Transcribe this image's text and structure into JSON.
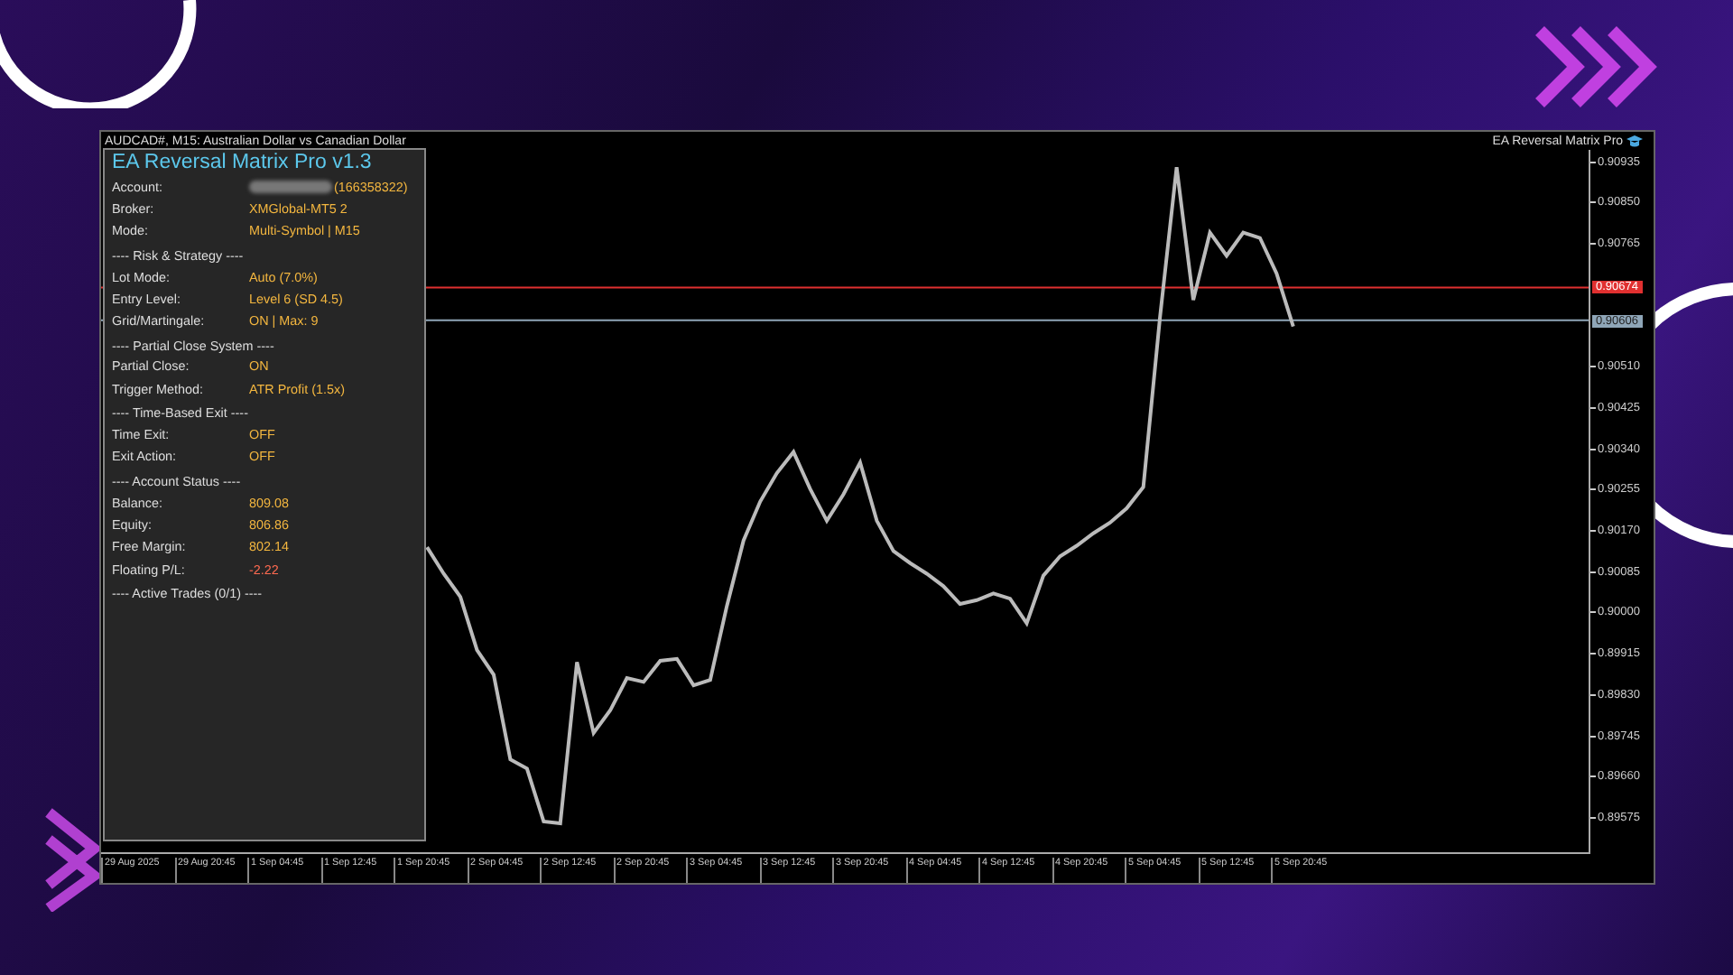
{
  "window": {
    "title": "AUDCAD#, M15:  Australian Dollar vs Canadian Dollar",
    "ea_label": "EA Reversal Matrix Pro"
  },
  "panel": {
    "title": "EA Reversal Matrix Pro v1.3",
    "rows": [
      {
        "kind": "field",
        "label": "Account:",
        "value": "(166358322)",
        "redacted": true,
        "negative": false
      },
      {
        "kind": "field",
        "label": "Broker:",
        "value": "XMGlobal-MT5 2",
        "redacted": false,
        "negative": false
      },
      {
        "kind": "field",
        "label": "Mode:",
        "value": "Multi-Symbol | M15",
        "redacted": false,
        "negative": false
      },
      {
        "kind": "section",
        "label": "---- Risk & Strategy ----"
      },
      {
        "kind": "field",
        "label": "Lot Mode:",
        "value": "Auto (7.0%)",
        "redacted": false,
        "negative": false
      },
      {
        "kind": "field",
        "label": "Entry Level:",
        "value": "Level 6 (SD 4.5)",
        "redacted": false,
        "negative": false
      },
      {
        "kind": "field",
        "label": "Grid/Martingale:",
        "value": "ON | Max: 9",
        "redacted": false,
        "negative": false
      },
      {
        "kind": "section",
        "label": "---- Partial Close System ----"
      },
      {
        "kind": "field",
        "label": "Partial Close:",
        "value": "ON",
        "redacted": false,
        "negative": false
      },
      {
        "kind": "field",
        "label": "Trigger Method:",
        "value": "ATR Profit (1.5x)",
        "redacted": false,
        "negative": false
      },
      {
        "kind": "section",
        "label": "---- Time-Based Exit ----"
      },
      {
        "kind": "field",
        "label": "Time Exit:",
        "value": "OFF",
        "redacted": false,
        "negative": false
      },
      {
        "kind": "field",
        "label": "Exit Action:",
        "value": "OFF",
        "redacted": false,
        "negative": false
      },
      {
        "kind": "section",
        "label": "---- Account Status ----"
      },
      {
        "kind": "field",
        "label": "Balance:",
        "value": "809.08",
        "redacted": false,
        "negative": false
      },
      {
        "kind": "field",
        "label": "Equity:",
        "value": "806.86",
        "redacted": false,
        "negative": false
      },
      {
        "kind": "field",
        "label": "Free Margin:",
        "value": "802.14",
        "redacted": false,
        "negative": false
      },
      {
        "kind": "field",
        "label": "Floating P/L:",
        "value": "-2.22",
        "redacted": false,
        "negative": true
      },
      {
        "kind": "section",
        "label": "---- Active Trades (0/1) ----"
      }
    ]
  },
  "chart": {
    "chart_data": {
      "type": "line",
      "ylim": [
        0.895,
        0.9096
      ],
      "yticks": [
        {
          "value": 0.90935,
          "label": "0.90935"
        },
        {
          "value": 0.9085,
          "label": "0.90850"
        },
        {
          "value": 0.90765,
          "label": "0.90765"
        },
        {
          "value": 0.9051,
          "label": "0.90510"
        },
        {
          "value": 0.90425,
          "label": "0.90425"
        },
        {
          "value": 0.9034,
          "label": "0.90340"
        },
        {
          "value": 0.90255,
          "label": "0.90255"
        },
        {
          "value": 0.9017,
          "label": "0.90170"
        },
        {
          "value": 0.90085,
          "label": "0.90085"
        },
        {
          "value": 0.9,
          "label": "0.90000"
        },
        {
          "value": 0.89915,
          "label": "0.89915"
        },
        {
          "value": 0.8983,
          "label": "0.89830"
        },
        {
          "value": 0.89745,
          "label": "0.89745"
        },
        {
          "value": 0.8966,
          "label": "0.89660"
        },
        {
          "value": 0.89575,
          "label": "0.89575"
        }
      ],
      "series": [
        {
          "color": "#bbbbbb",
          "values": [
            0.90134,
            0.90079,
            0.90031,
            0.8992,
            0.89869,
            0.89693,
            0.89674,
            0.89564,
            0.8956,
            0.89895,
            0.89748,
            0.89795,
            0.89862,
            0.89854,
            0.89898,
            0.89902,
            0.89847,
            0.89858,
            0.90012,
            0.90148,
            0.90229,
            0.90288,
            0.90332,
            0.90255,
            0.90189,
            0.90244,
            0.9031,
            0.90189,
            0.90126,
            0.90101,
            0.90079,
            0.90053,
            0.90016,
            0.90024,
            0.90038,
            0.90027,
            0.89976,
            0.90075,
            0.90115,
            0.90137,
            0.90163,
            0.90185,
            0.90215,
            0.90259,
            0.90612,
            0.90924,
            0.90648,
            0.90788,
            0.9074,
            0.90788,
            0.90777,
            0.90703,
            0.90593
          ]
        }
      ],
      "ref_lines": [
        {
          "axis": "y",
          "value": 0.90674,
          "label": "0.90674",
          "color": "#e03030"
        },
        {
          "axis": "y",
          "value": 0.90606,
          "label": "0.90606",
          "color": "#8fa6b8"
        }
      ]
    }
  },
  "time_axis": {
    "labels": [
      "29 Aug 2025",
      "29 Aug 20:45",
      "1 Sep 04:45",
      "1 Sep 12:45",
      "1 Sep 20:45",
      "2 Sep 04:45",
      "2 Sep 12:45",
      "2 Sep 20:45",
      "3 Sep 04:45",
      "3 Sep 12:45",
      "3 Sep 20:45",
      "4 Sep 04:45",
      "4 Sep 12:45",
      "4 Sep 20:45",
      "5 Sep 04:45",
      "5 Sep 12:45",
      "5 Sep 20:45"
    ]
  }
}
